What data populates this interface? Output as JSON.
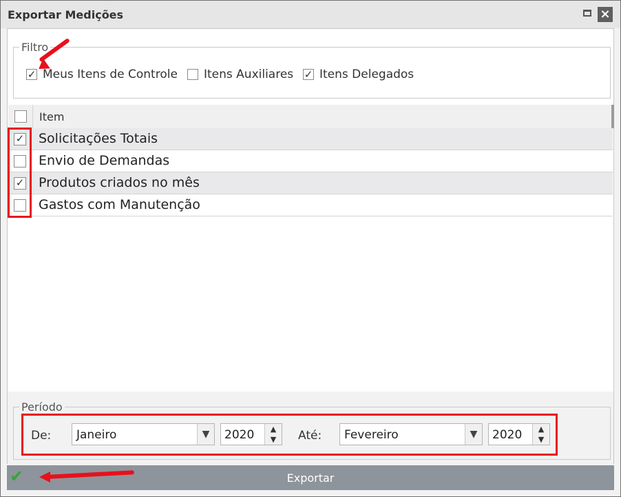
{
  "window": {
    "title": "Exportar Medições"
  },
  "filter": {
    "legend": "Filtro",
    "options": [
      {
        "label": "Meus Itens de Controle",
        "checked": true
      },
      {
        "label": "Itens Auxiliares",
        "checked": false
      },
      {
        "label": "Itens Delegados",
        "checked": true
      }
    ]
  },
  "grid": {
    "header": "Item",
    "rows": [
      {
        "label": "Solicitações Totais",
        "checked": true
      },
      {
        "label": "Envio de Demandas",
        "checked": false
      },
      {
        "label": "Produtos criados no mês",
        "checked": true
      },
      {
        "label": "Gastos com Manutenção",
        "checked": false
      }
    ]
  },
  "period": {
    "legend": "Período",
    "from_label": "De:",
    "from_month": "Janeiro",
    "from_year": "2020",
    "to_label": "Até:",
    "to_month": "Fevereiro",
    "to_year": "2020"
  },
  "footer": {
    "export_label": "Exportar"
  },
  "colors": {
    "accent_red": "#e8101c",
    "footer_bg": "#8e949b",
    "check_green": "#39a33b"
  },
  "check_glyph": "✓"
}
